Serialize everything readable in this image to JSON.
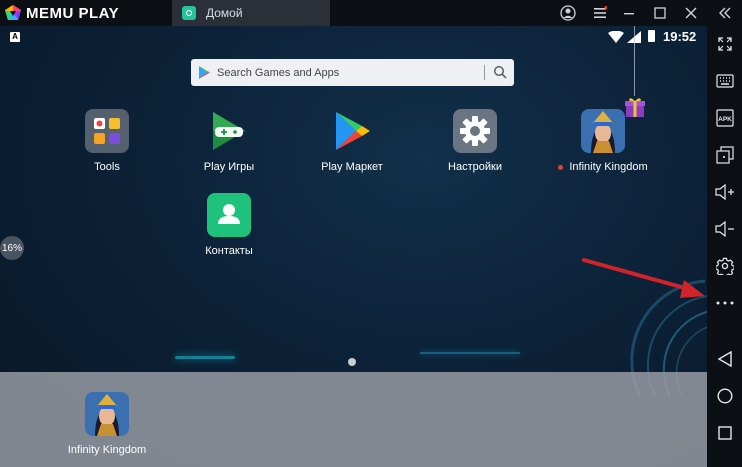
{
  "titlebar": {
    "brand": "MEMU PLAY",
    "tab_label": "Домой"
  },
  "statusbar": {
    "keyboard_indicator": "A",
    "time": "19:52"
  },
  "search": {
    "placeholder": "Search Games and Apps"
  },
  "apps": [
    {
      "label": "Tools"
    },
    {
      "label": "Play Игры"
    },
    {
      "label": "Play Маркет"
    },
    {
      "label": "Настройки"
    },
    {
      "label": "Infinity Kingdom"
    },
    {
      "label": "Контакты"
    }
  ],
  "progress_badge": "16%",
  "dock": {
    "apps": [
      {
        "label": "Infinity Kingdom"
      }
    ]
  },
  "colors": {
    "accent": "#27c39d",
    "arrow": "#d0232a",
    "notification": "#e0423a"
  }
}
